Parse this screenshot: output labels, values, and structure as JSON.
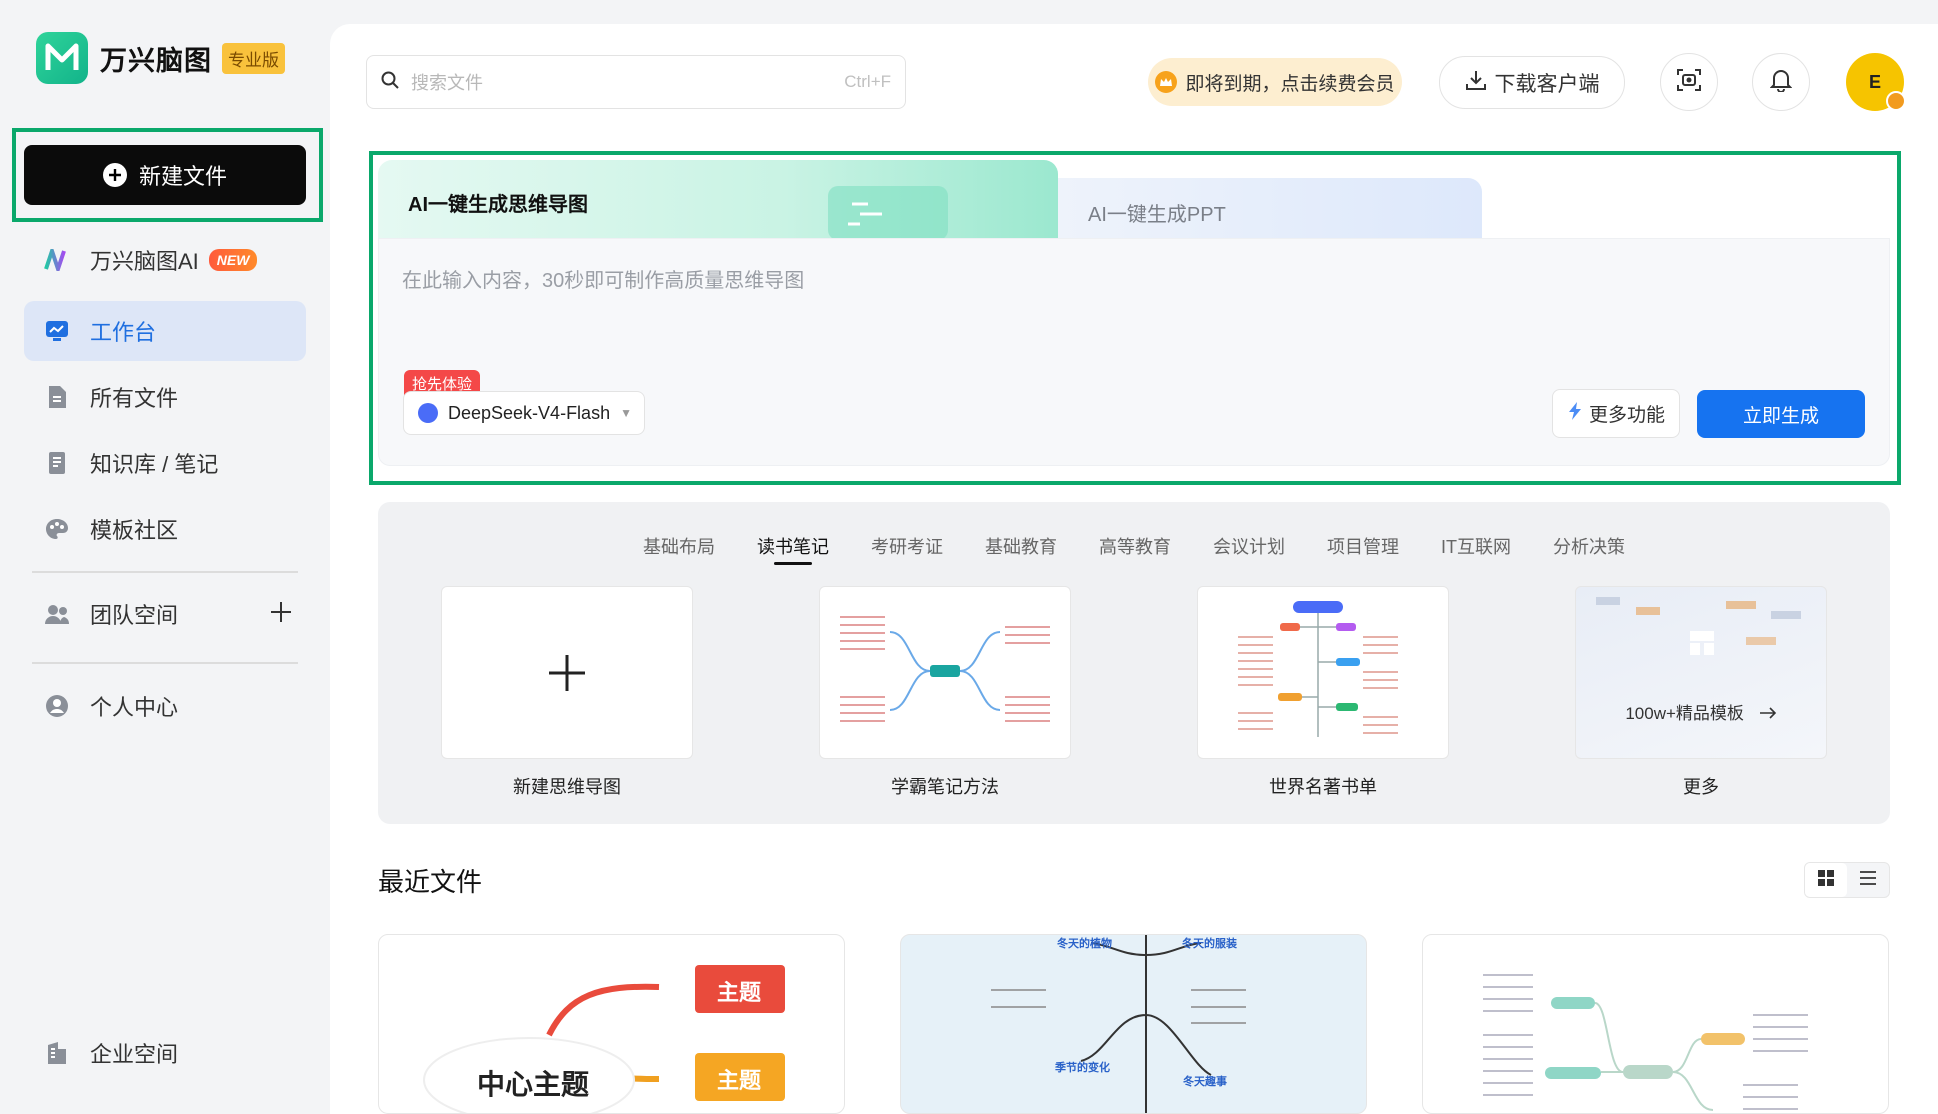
{
  "app": {
    "name": "万兴脑图",
    "edition_badge": "专业版"
  },
  "sidebar": {
    "new_file_label": "新建文件",
    "items": [
      {
        "label": "万兴脑图AI",
        "tag": "NEW",
        "icon": "ai-logo-icon"
      },
      {
        "label": "工作台",
        "icon": "workspace-icon",
        "active": true
      },
      {
        "label": "所有文件",
        "icon": "file-icon"
      },
      {
        "label": "知识库 / 笔记",
        "icon": "notebook-icon"
      },
      {
        "label": "模板社区",
        "icon": "palette-icon"
      }
    ],
    "team_space_label": "团队空间",
    "personal_center_label": "个人中心",
    "enterprise_label": "企业空间"
  },
  "header": {
    "search_placeholder": "搜索文件",
    "search_shortcut": "Ctrl+F",
    "renew_label": "即将到期，点击续费会员",
    "download_label": "下载客户端",
    "avatar_initial": "E"
  },
  "ai": {
    "tab_mindmap": "AI一键生成思维导图",
    "tab_ppt": "AI一键生成PPT",
    "input_placeholder": "在此输入内容，30秒即可制作高质量思维导图",
    "early_badge": "抢先体验",
    "model_label": "DeepSeek-V4-Flash",
    "more_label": "更多功能",
    "generate_label": "立即生成"
  },
  "templates": {
    "categories": [
      "基础布局",
      "读书笔记",
      "考研考证",
      "基础教育",
      "高等教育",
      "会议计划",
      "项目管理",
      "IT互联网",
      "分析决策"
    ],
    "active_category": "读书笔记",
    "cards": [
      {
        "label": "新建思维导图"
      },
      {
        "label": "学霸笔记方法"
      },
      {
        "label": "世界名著书单"
      },
      {
        "label": "更多",
        "overlay": "100w+精品模板"
      }
    ]
  },
  "recent": {
    "title": "最近文件",
    "card1": {
      "topic1": "主题",
      "topic2": "主题",
      "center": "中心主题"
    },
    "card2": {
      "n1": "冬天的植物",
      "n2": "冬天的服装",
      "n3": "季节的变化",
      "n4": "冬天趣事"
    }
  },
  "colors": {
    "accent_blue": "#1673f0",
    "highlight_green": "#0aa86b",
    "active_nav_bg": "#dde6f7"
  }
}
